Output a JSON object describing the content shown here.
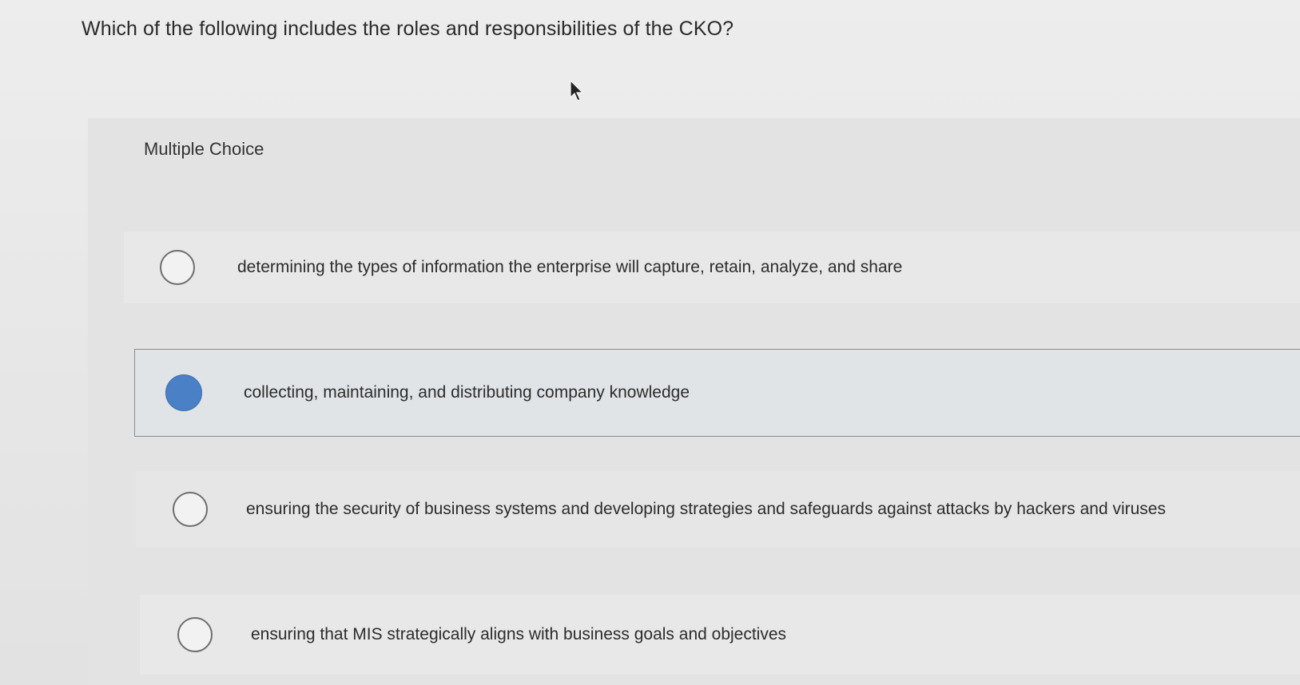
{
  "question": {
    "text": "Which of the following includes the roles and responsibilities of the CKO?"
  },
  "section": {
    "label": "Multiple Choice"
  },
  "options": [
    {
      "text": "determining the types of information the enterprise will capture, retain, analyze, and share",
      "selected": false
    },
    {
      "text": "collecting, maintaining, and distributing company knowledge",
      "selected": true
    },
    {
      "text": "ensuring the security of business systems and developing strategies and safeguards against attacks by hackers and viruses",
      "selected": false
    },
    {
      "text": "ensuring that MIS strategically aligns with business goals and objectives",
      "selected": false
    }
  ],
  "colors": {
    "selected_radio": "#4a80c6",
    "selected_row_bg": "#e0e4e7",
    "background": "#e9e9e9"
  },
  "icons": {
    "cursor": "mouse-pointer-icon",
    "radio_unchecked": "radio-unchecked-icon",
    "radio_checked": "radio-checked-icon"
  }
}
